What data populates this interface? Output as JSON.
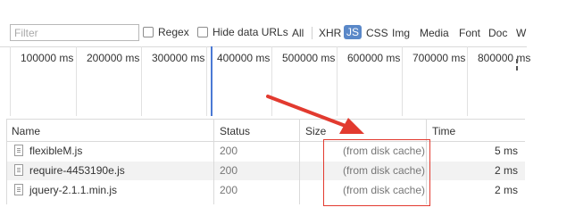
{
  "filterbar": {
    "filter_placeholder": "Filter",
    "regex_label": "Regex",
    "hide_data_urls_label": "Hide data URLs",
    "types": [
      "All",
      "XHR",
      "JS",
      "CSS",
      "Img",
      "Media",
      "Font",
      "Doc",
      "W"
    ],
    "active_type": "JS"
  },
  "timeline": {
    "ticks": [
      "100000 ms",
      "200000 ms",
      "300000 ms",
      "400000 ms",
      "500000 ms",
      "600000 ms",
      "700000 ms",
      "800000 ms"
    ]
  },
  "table": {
    "columns": {
      "name": "Name",
      "status": "Status",
      "size": "Size",
      "time": "Time"
    },
    "rows": [
      {
        "name": "flexibleM.js",
        "status": "200",
        "size": "(from disk cache)",
        "time": "5 ms"
      },
      {
        "name": "require-4453190e.js",
        "status": "200",
        "size": "(from disk cache)",
        "time": "2 ms"
      },
      {
        "name": "jquery-2.1.1.min.js",
        "status": "200",
        "size": "(from disk cache)",
        "time": "2 ms"
      }
    ]
  },
  "colors": {
    "annotation": "#e23a2f",
    "active_filter": "#5a88c8",
    "timeline_marker": "#4b79d4"
  }
}
